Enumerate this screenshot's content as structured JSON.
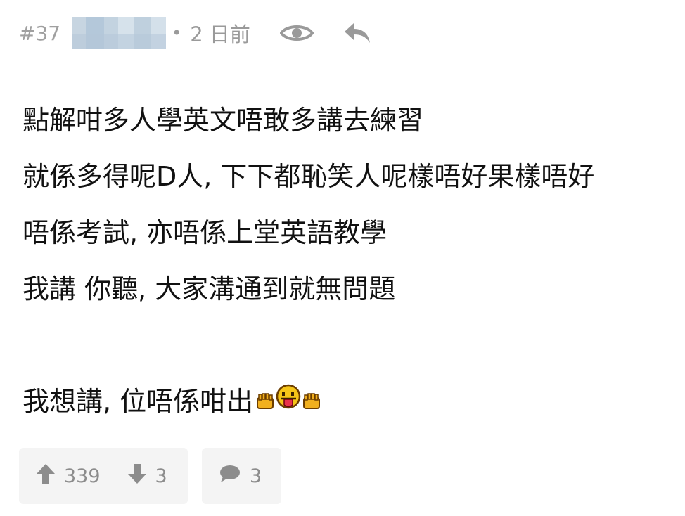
{
  "post": {
    "floor": "#37",
    "separator": "•",
    "time": "2 日前",
    "lines": [
      "點解咁多人學英文唔敢多講去練習",
      "就係多得呢D人, 下下都恥笑人呢樣唔好果樣唔好",
      "唔係考試, 亦唔係上堂英語教學",
      "我講 你聽, 大家溝通到就無問題",
      "",
      "我想講, 位唔係咁出"
    ],
    "emojis": [
      "clap-hand",
      "tongue-face",
      "clap-hand"
    ]
  },
  "actions": {
    "upvotes": "339",
    "downvotes": "3",
    "comments": "3"
  },
  "colors": {
    "meta_gray": "#9a9a9a",
    "action_bg": "#f4f4f4",
    "action_text": "#8c8c8c",
    "emoji_yellow": "#f2b01e"
  }
}
